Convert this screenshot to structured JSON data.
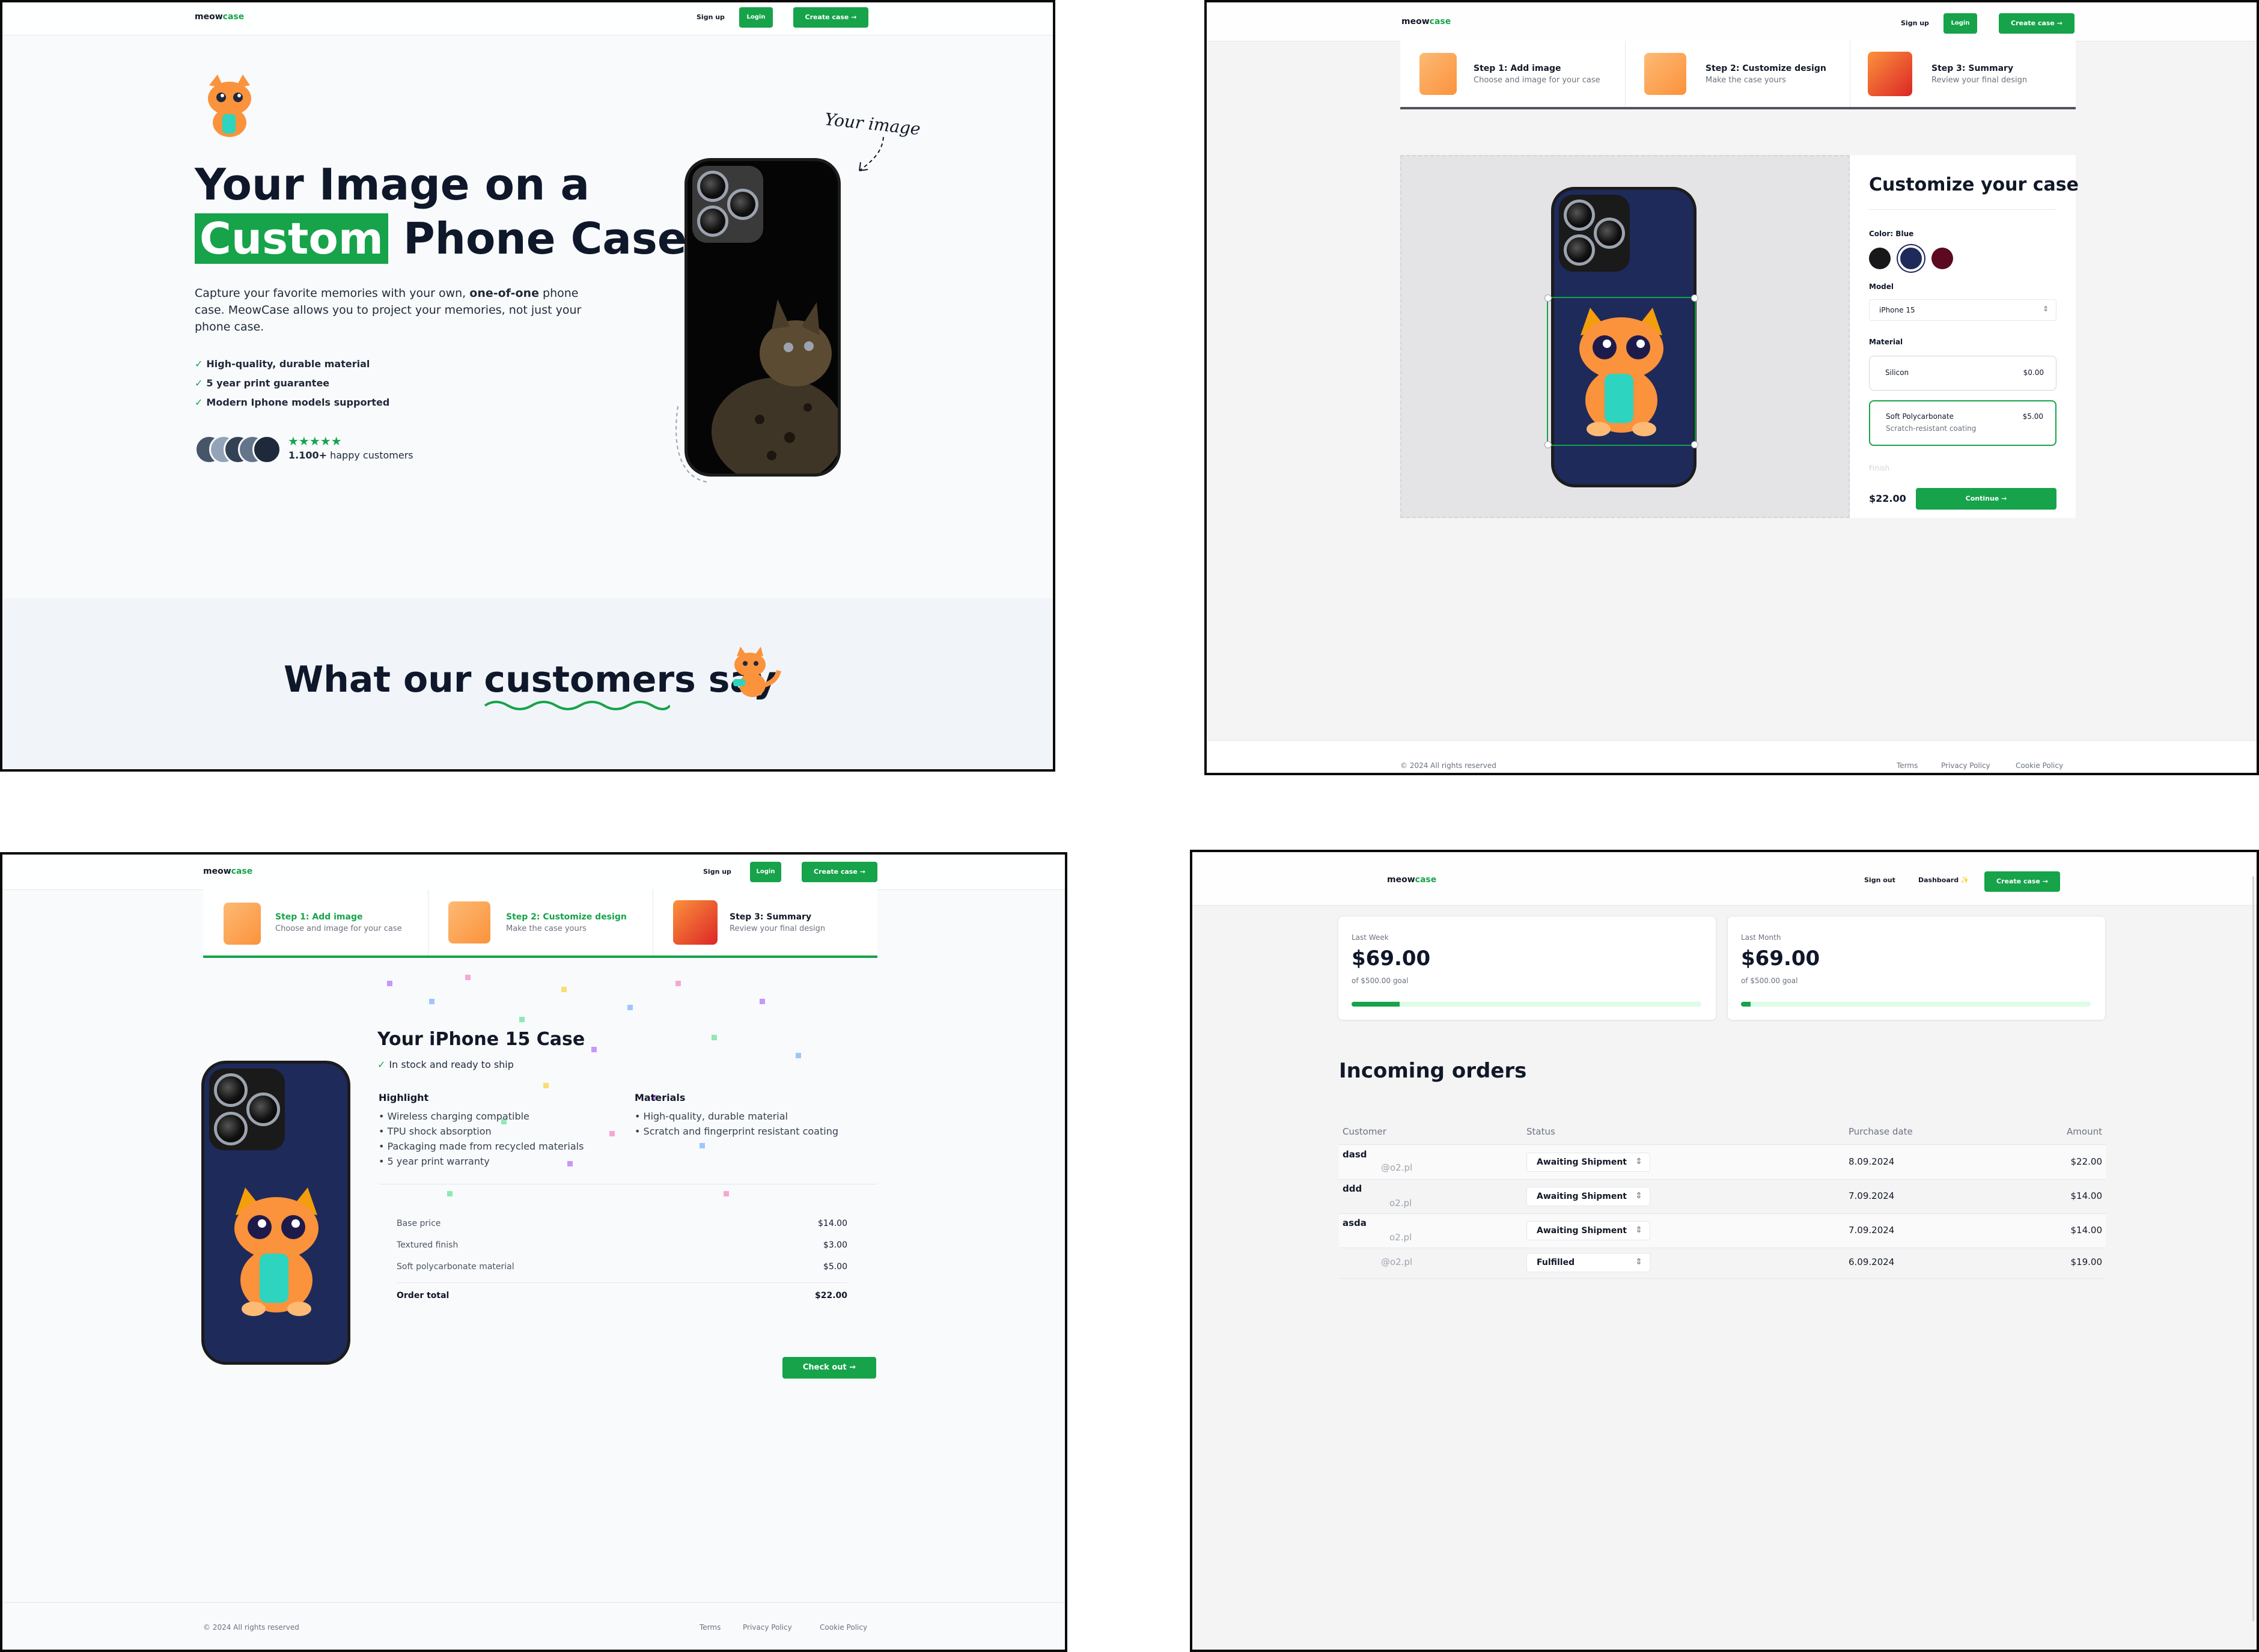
{
  "brand": {
    "left": "meow",
    "right": "case"
  },
  "nav": {
    "signup": "Sign up",
    "login": "Login",
    "create_case": "Create case",
    "signout": "Sign out",
    "dashboard": "Dashboard ✨"
  },
  "landing": {
    "title_line1": "Your Image on a",
    "title_highlight": "Custom",
    "title_rest": "Phone Case",
    "desc_part1": "Capture your favorite memories with your own, ",
    "desc_bold": "one-of-one",
    "desc_part2": " phone case. MeowCase allows you to project your memories, not just your phone case.",
    "features": [
      "High-quality, durable material",
      "5 year print guarantee",
      "Modern Iphone models supported"
    ],
    "stars": "★★★★★",
    "customers_bold": "1.100+",
    "customers_rest": "happy customers",
    "your_image": "Your image",
    "testimonials_pre": "What our",
    "testimonials_highlight": "customers",
    "testimonials_post": "say"
  },
  "steps": [
    {
      "title": "Step 1: Add image",
      "sub": "Choose and image for your case"
    },
    {
      "title": "Step 2: Customize design",
      "sub": "Make the case yours"
    },
    {
      "title": "Step 3: Summary",
      "sub": "Review your final design"
    }
  ],
  "design": {
    "heading": "Customize your case",
    "color_label": "Color: Blue",
    "colors": [
      "#18181b",
      "#1e2a5a",
      "#5b0a1f"
    ],
    "model_label": "Model",
    "model_value": "iPhone 15",
    "material_label": "Material",
    "materials": [
      {
        "name": "Silicon",
        "price": "$0.00",
        "sub": ""
      },
      {
        "name": "Soft Polycarbonate",
        "price": "$5.00",
        "sub": "Scratch-resistant coating"
      }
    ],
    "finish_label": "Finish",
    "total": "$22.00",
    "continue": "Continue"
  },
  "footer": {
    "copyright": "© 2024 All rights reserved",
    "terms": "Terms",
    "privacy": "Privacy Policy",
    "cookie": "Cookie Policy"
  },
  "summary": {
    "title": "Your iPhone 15 Case",
    "stock": "In stock and ready to ship",
    "highlight_label": "Highlight",
    "highlights": [
      "Wireless charging compatible",
      "TPU shock absorption",
      "Packaging made from recycled materials",
      "5 year print warranty"
    ],
    "materials_label": "Materials",
    "materials": [
      "High-quality, durable material",
      "Scratch and fingerprint resistant coating"
    ],
    "price_rows": [
      {
        "label": "Base price",
        "value": "$14.00"
      },
      {
        "label": "Textured finish",
        "value": "$3.00"
      },
      {
        "label": "Soft polycarbonate material",
        "value": "$5.00"
      }
    ],
    "order_total_label": "Order total",
    "order_total": "$22.00",
    "checkout": "Check out"
  },
  "dashboard": {
    "last_week_label": "Last Week",
    "last_week_value": "$69.00",
    "last_week_goal": "of $500.00 goal",
    "last_week_progress": 0.138,
    "last_month_label": "Last Month",
    "last_month_value": "$69.00",
    "last_month_goal": "of $500.00 goal",
    "last_month_progress": 0.028,
    "orders_title": "Incoming orders",
    "columns": [
      "Customer",
      "Status",
      "Purchase date",
      "Amount"
    ],
    "orders": [
      {
        "name": "dasd",
        "email": "@o2.pl",
        "status": "Awaiting Shipment",
        "date": "8.09.2024",
        "amount": "$22.00"
      },
      {
        "name": "ddd",
        "email": "o2.pl",
        "status": "Awaiting Shipment",
        "date": "7.09.2024",
        "amount": "$14.00"
      },
      {
        "name": "asda",
        "email": "o2.pl",
        "status": "Awaiting Shipment",
        "date": "7.09.2024",
        "amount": "$14.00"
      },
      {
        "name": "",
        "email": "@o2.pl",
        "status": "Fulfilled",
        "date": "6.09.2024",
        "amount": "$19.00"
      }
    ]
  }
}
